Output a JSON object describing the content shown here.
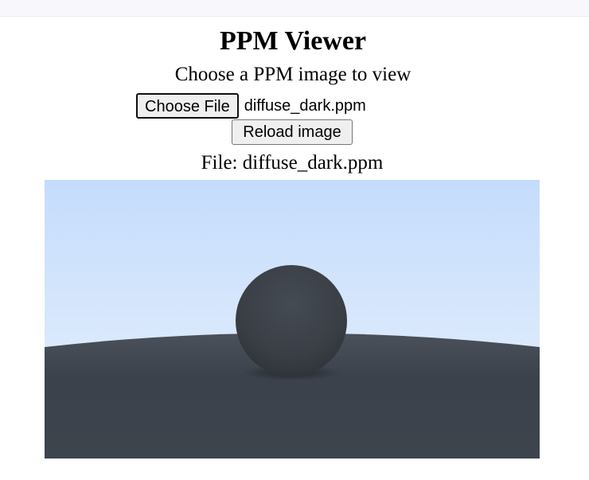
{
  "app": {
    "title": "PPM Viewer",
    "subtitle": "Choose a PPM image to view"
  },
  "file_input": {
    "button_label": "Choose File",
    "selected_file": "diffuse_dark.ppm"
  },
  "reload": {
    "label": "Reload image"
  },
  "caption": {
    "text": "File: diffuse_dark.ppm"
  },
  "image": {
    "sky_top_color": "#c4dcfc",
    "sky_bottom_color": "#eaf2fb",
    "ground_color": "#3c424b",
    "sphere_color": "#3a3f46"
  }
}
